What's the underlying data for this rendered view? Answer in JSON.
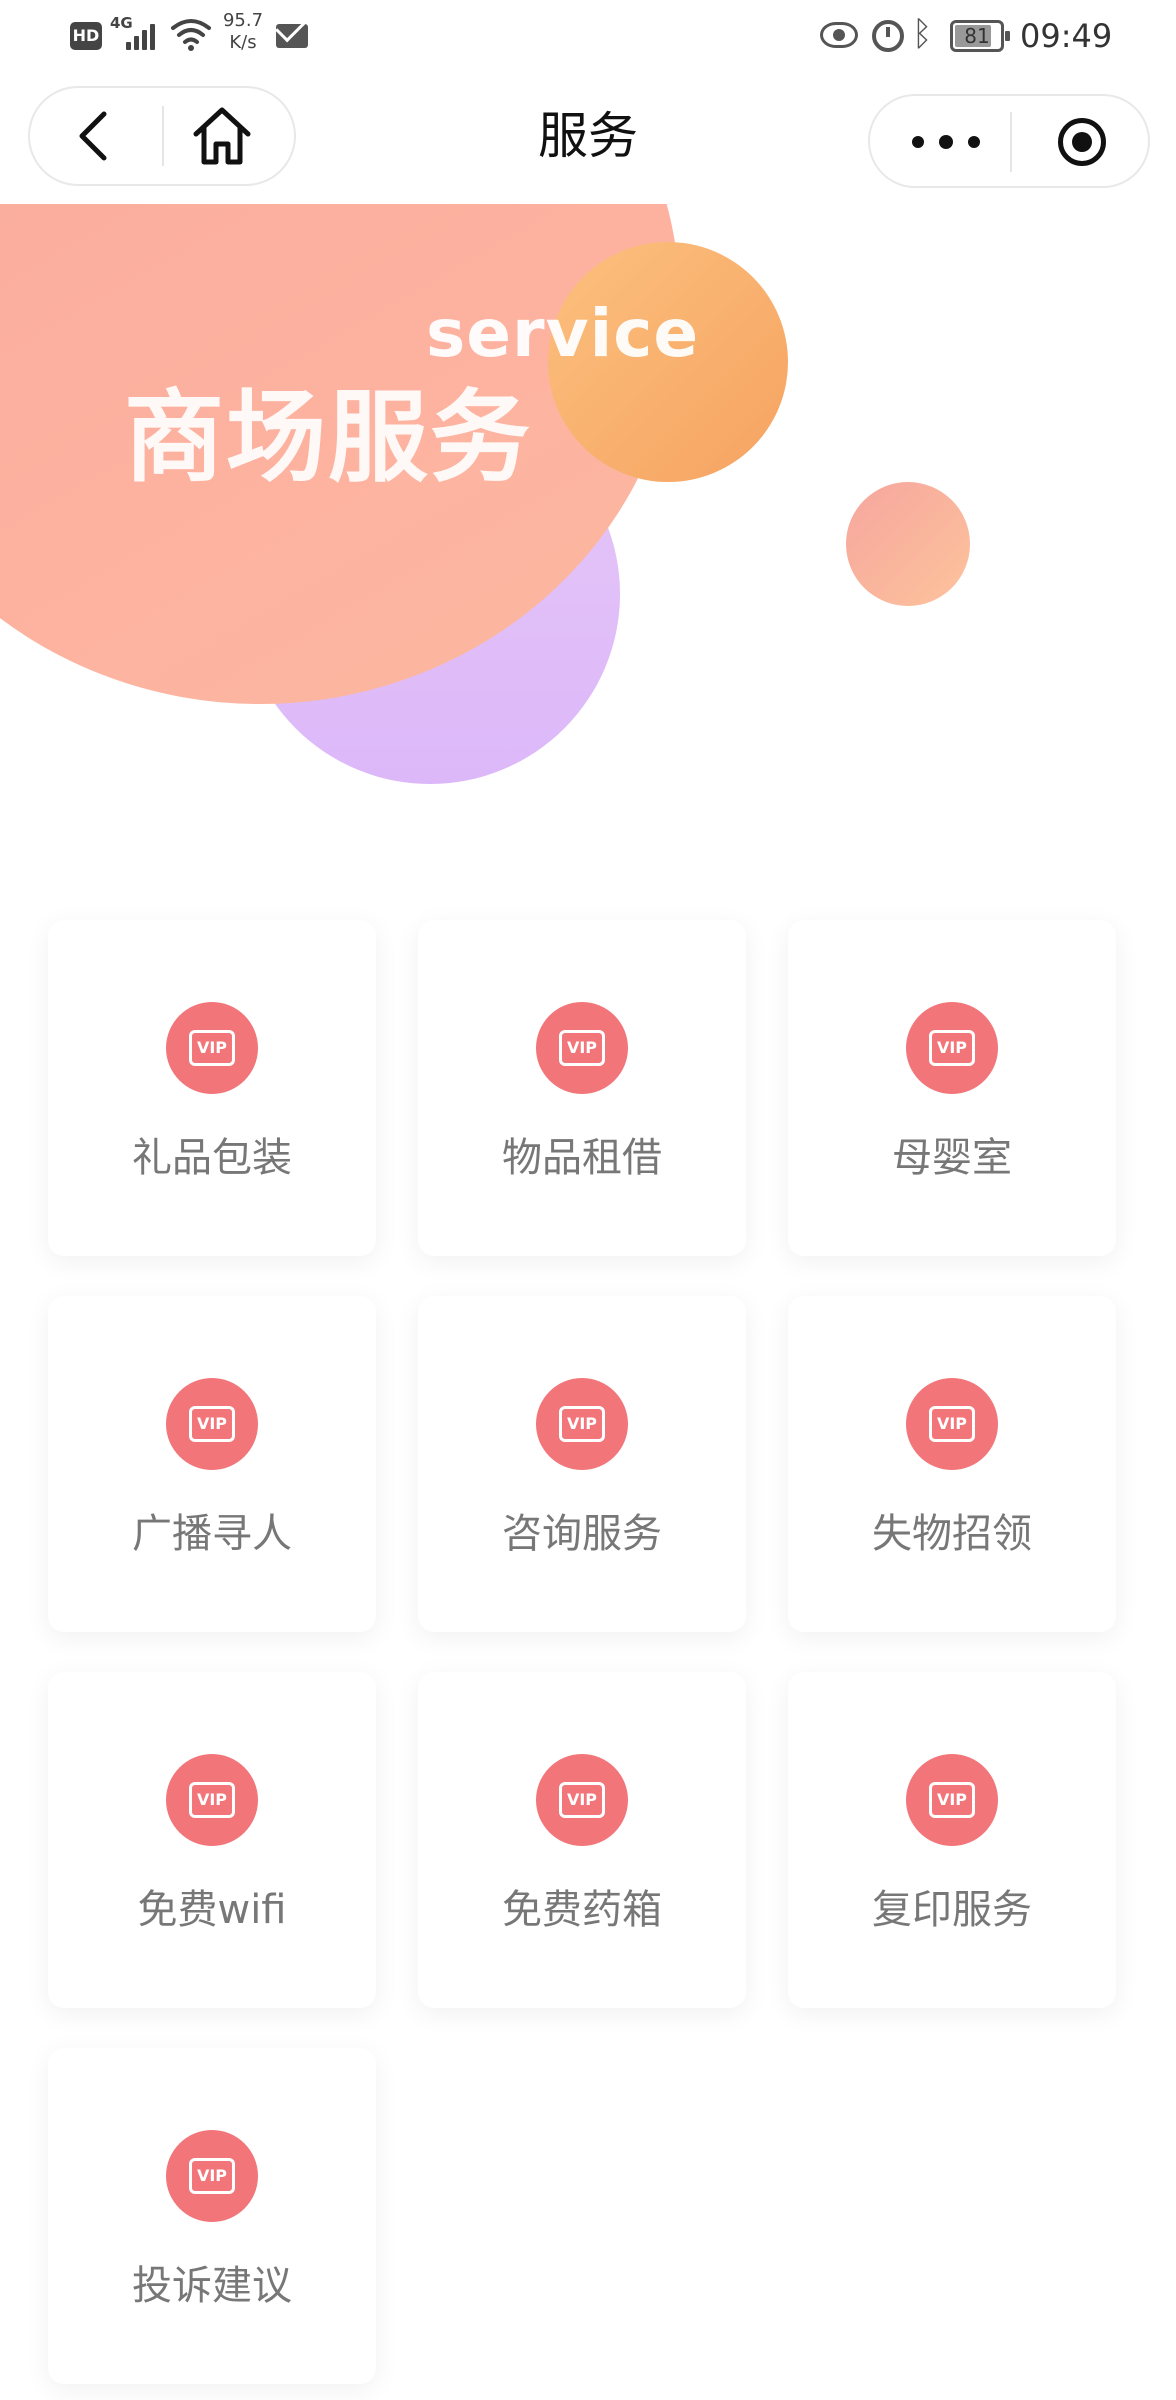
{
  "status_bar": {
    "hd": "HD",
    "network": "4G",
    "speed_value": "95.7",
    "speed_unit": "K/s",
    "battery": "81",
    "battery_fraction": 0.81,
    "time": "09:49",
    "icons": [
      "signal-icon",
      "wifi-icon",
      "mail-icon",
      "eye-icon",
      "alarm-icon",
      "bluetooth-icon",
      "battery-icon"
    ]
  },
  "nav": {
    "title": "服务",
    "back_icon": "chevron-left-icon",
    "home_icon": "home-icon",
    "more_icon": "more-dots-icon",
    "target_icon": "target-icon"
  },
  "banner": {
    "english": "service",
    "chinese": "商场服务",
    "colors": {
      "main_blob": "#fcb29f",
      "orange_blob": "#f7a964",
      "purple_blob": "#e0bdf8",
      "small_blob": "#f9b09e"
    }
  },
  "services": {
    "icon": "vip-icon",
    "icon_text": "VIP",
    "accent": "#f2757a",
    "items": [
      {
        "label": "礼品包装"
      },
      {
        "label": "物品租借"
      },
      {
        "label": "母婴室"
      },
      {
        "label": "广播寻人"
      },
      {
        "label": "咨询服务"
      },
      {
        "label": "失物招领"
      },
      {
        "label": "免费wifi"
      },
      {
        "label": "免费药箱"
      },
      {
        "label": "复印服务"
      },
      {
        "label": "投诉建议"
      }
    ]
  }
}
